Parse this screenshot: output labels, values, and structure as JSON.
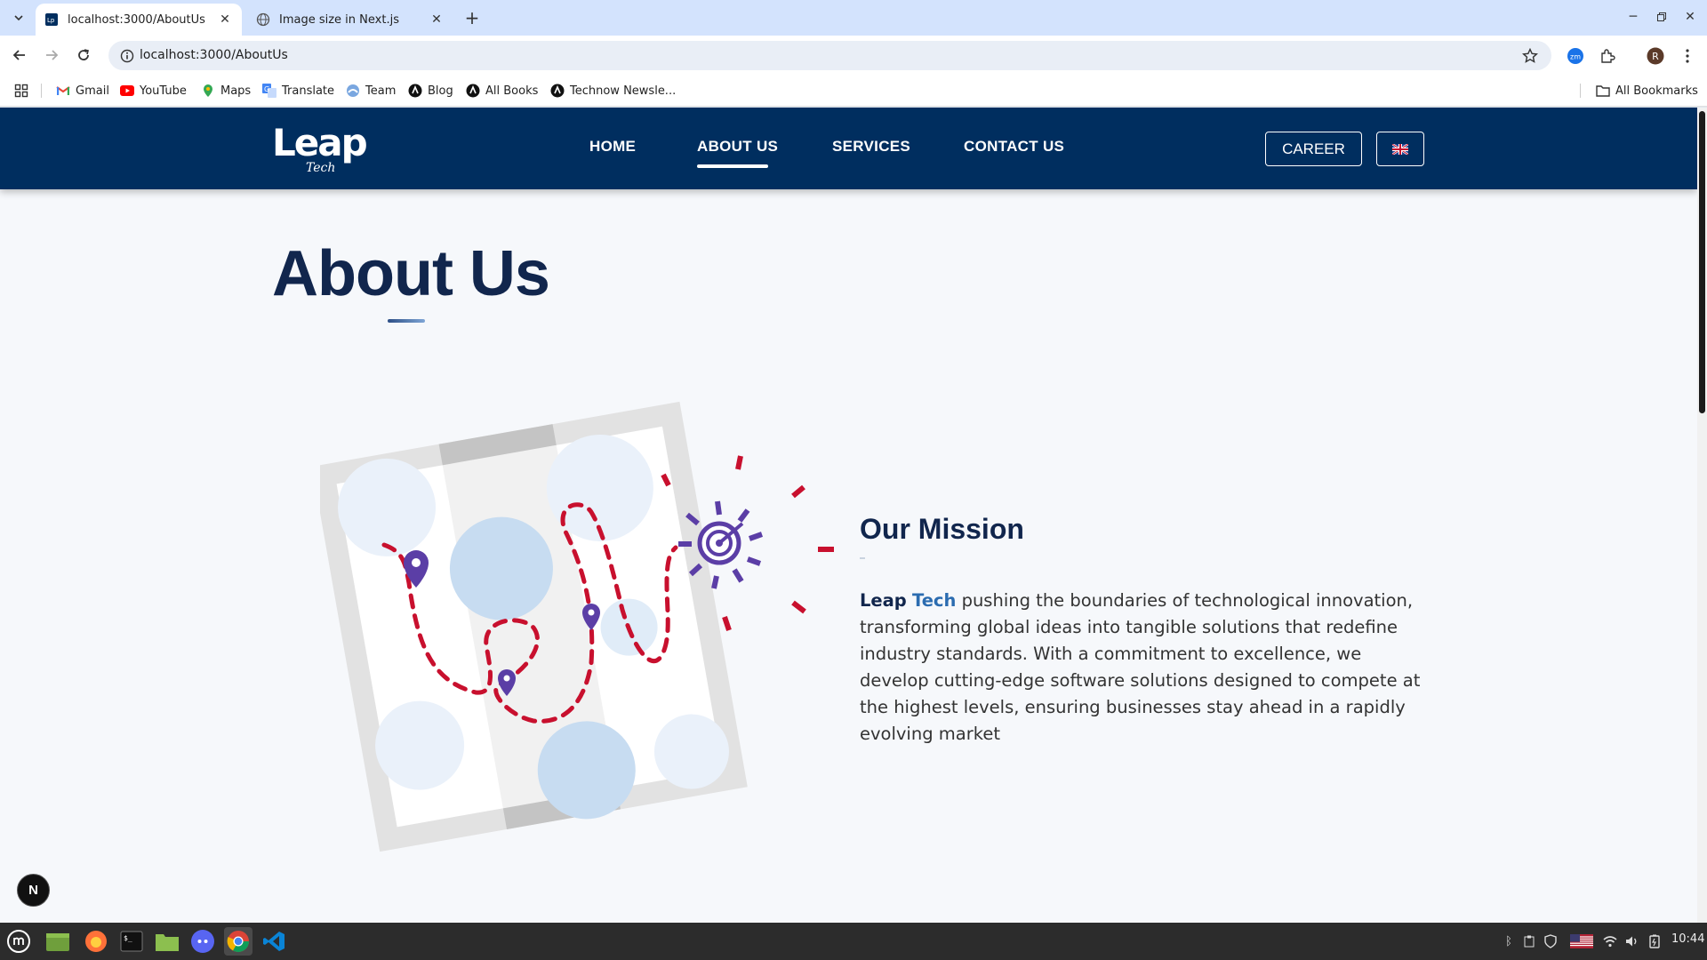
{
  "browser": {
    "tabs": [
      {
        "title": "localhost:3000/AboutUs",
        "active": true
      },
      {
        "title": "Image size in Next.js",
        "active": false
      }
    ],
    "url": "localhost:3000/AboutUs",
    "bookmarks": [
      {
        "label": "Gmail",
        "icon": "gmail-icon"
      },
      {
        "label": "YouTube",
        "icon": "youtube-icon"
      },
      {
        "label": "Maps",
        "icon": "maps-icon"
      },
      {
        "label": "Translate",
        "icon": "translate-icon"
      },
      {
        "label": "Team",
        "icon": "team-icon"
      },
      {
        "label": "Blog",
        "icon": "blog-icon"
      },
      {
        "label": "All Books",
        "icon": "books-icon"
      },
      {
        "label": "Technow Newsle...",
        "icon": "newsletter-icon"
      }
    ],
    "all_bookmarks": "All Bookmarks",
    "profile_initial": "R"
  },
  "site": {
    "logo_text": "Leap",
    "logo_sub": "Tech",
    "nav": [
      {
        "label": "HOME",
        "active": false
      },
      {
        "label": "ABOUT US",
        "active": true
      },
      {
        "label": "SERVICES",
        "active": false
      },
      {
        "label": "CONTACT US",
        "active": false
      }
    ],
    "career_label": "CAREER",
    "language": "🇬🇧",
    "colors": {
      "nav_bg": "#002e5f",
      "title": "#11264d",
      "accent": "#2b6cb0",
      "route_red": "#c8102e",
      "pin_purple": "#5b3ea6"
    }
  },
  "main": {
    "page_title": "About Us",
    "mission": {
      "heading": "Our Mission",
      "brand_part1": "Leap",
      "brand_part2": "Tech",
      "body": " pushing the boundaries of technological innovation, transforming global ideas into tangible solutions that redefine industry standards. With a commitment to excellence, we develop cutting-edge software solutions designed to compete at the highest levels, ensuring businesses stay ahead in a rapidly evolving market"
    }
  },
  "devtools": {
    "badge": "N"
  },
  "taskbar": {
    "apps": [
      "mint-menu-icon",
      "files-icon",
      "firefox-icon",
      "terminal-icon",
      "folder-icon",
      "discord-icon",
      "chrome-icon",
      "vscode-icon"
    ],
    "clock": "10:44"
  }
}
